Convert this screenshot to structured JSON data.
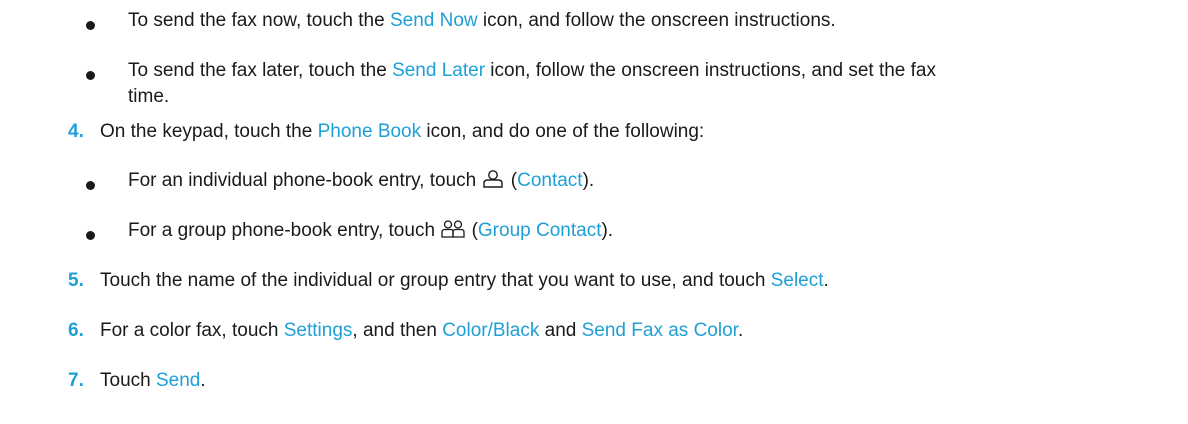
{
  "steps": [
    {
      "kind": "bullet",
      "parts": [
        "To send the fax now, touch the ",
        "Send Now",
        " icon, and follow the onscreen instructions."
      ]
    },
    {
      "kind": "bullet",
      "parts": [
        "To send the fax later, touch the ",
        "Send Later",
        " icon, follow the onscreen instructions, and set the fax"
      ],
      "continuation": "time."
    },
    {
      "kind": "step",
      "number": "4.",
      "parts": [
        "On the keypad, touch the ",
        "Phone Book",
        " icon, and do one of the following:"
      ]
    },
    {
      "kind": "bullet",
      "parts": [
        "For an individual phone-book entry, touch ",
        "icon:contact-icon",
        " (",
        "Contact",
        ")."
      ]
    },
    {
      "kind": "bullet",
      "parts": [
        "For a group phone-book entry, touch ",
        "icon:group-contact-icon",
        " (",
        "Group Contact",
        ")."
      ]
    },
    {
      "kind": "step",
      "number": "5.",
      "parts": [
        "Touch the name of the individual or group entry that you want to use, and touch ",
        "Select",
        "."
      ]
    },
    {
      "kind": "step",
      "number": "6.",
      "parts": [
        "For a color fax, touch ",
        "Settings",
        ", and then ",
        "Color/Black",
        " and ",
        "Send Fax as Color",
        "."
      ]
    },
    {
      "kind": "step",
      "number": "7.",
      "parts": [
        "Touch ",
        "Send",
        "."
      ]
    }
  ],
  "colors": {
    "accent": "#1e9fd6",
    "text": "#1a1a1a"
  }
}
